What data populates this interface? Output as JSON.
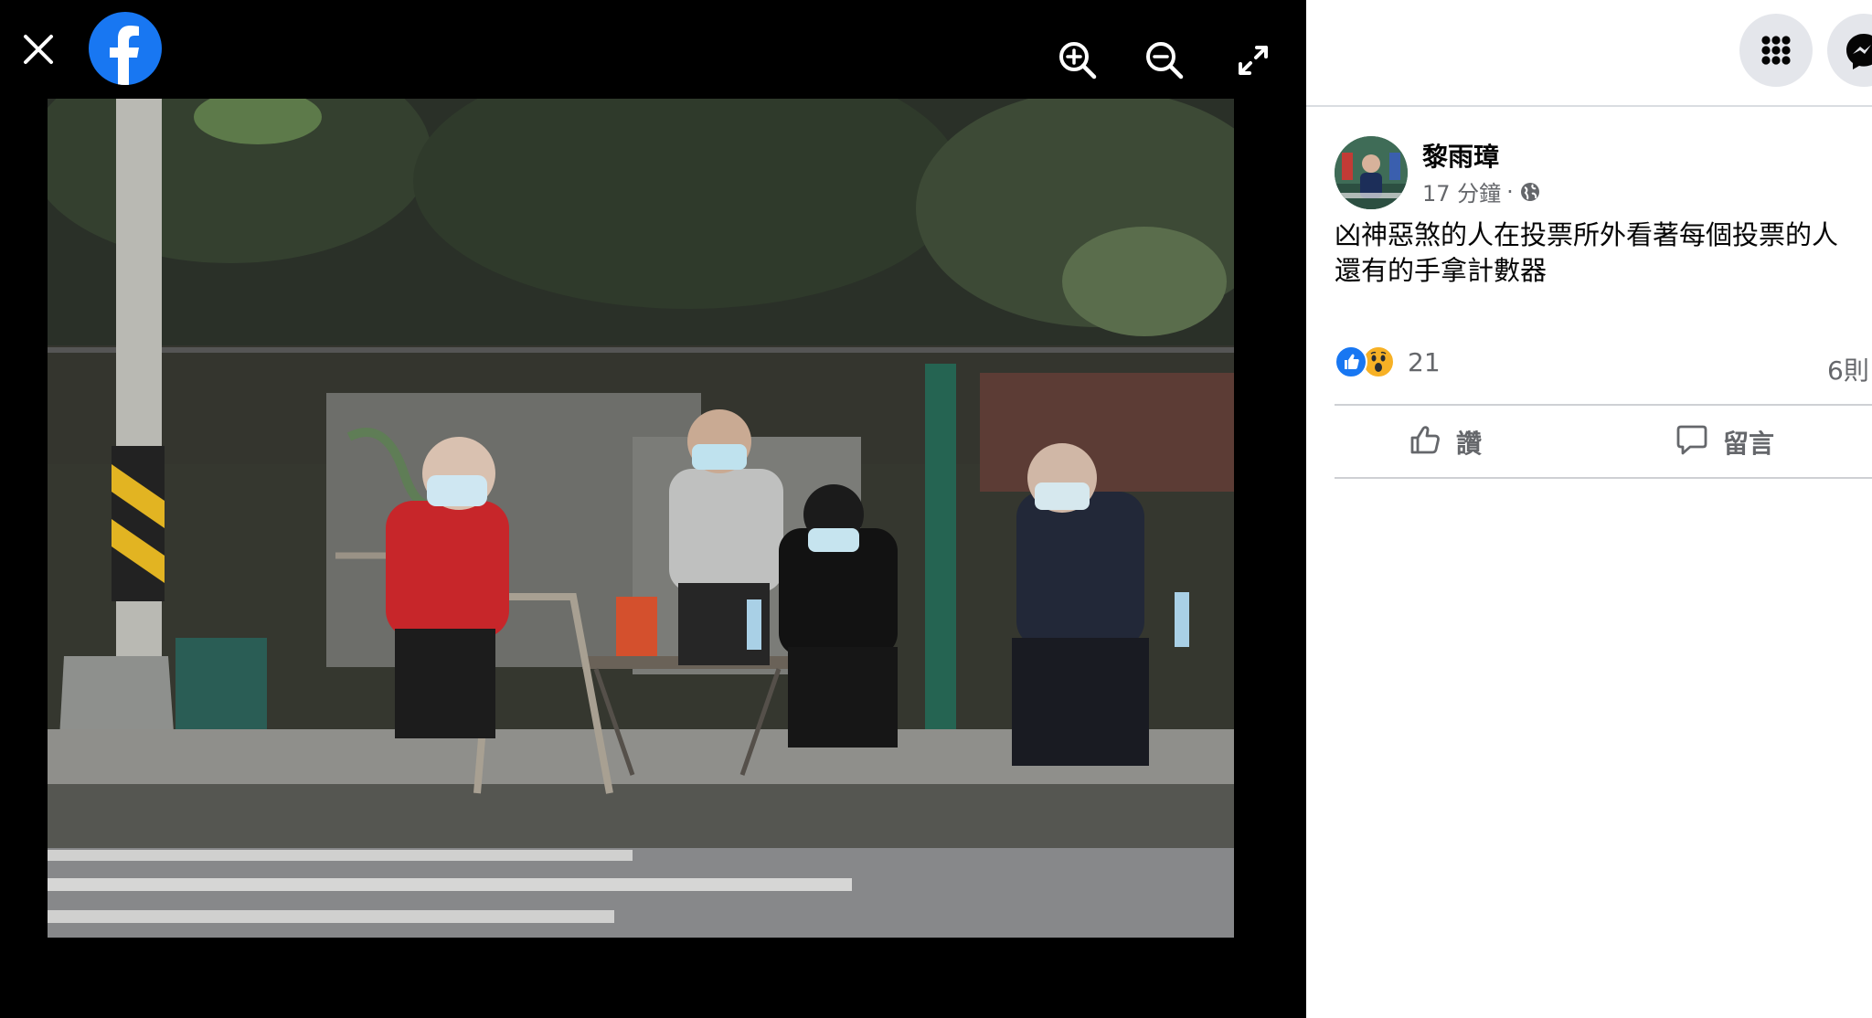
{
  "viewer": {
    "close_icon": "close-icon",
    "logo_icon": "facebook-logo-icon",
    "zoom_in_icon": "zoom-in-icon",
    "zoom_out_icon": "zoom-out-icon",
    "fullscreen_icon": "fullscreen-icon",
    "background_color": "#000000",
    "logo_color": "#1877f2"
  },
  "header": {
    "menu_icon": "grid-menu-icon",
    "messenger_icon": "messenger-icon"
  },
  "post": {
    "author": "黎雨璋",
    "time": "17 分鐘",
    "separator": "·",
    "privacy_icon": "globe-icon",
    "text_line1": "凶神惡煞的人在投票所外看著每個投票的人",
    "text_line2": "還有的手拿計數器",
    "reaction_icons": [
      "like-reaction-icon",
      "wow-reaction-icon"
    ],
    "reaction_count": "21",
    "comment_count": "6則"
  },
  "actions": {
    "like_label": "讚",
    "comment_label": "留言"
  },
  "colors": {
    "text_primary": "#050505",
    "text_secondary": "#65676b",
    "like_blue": "#1877f2",
    "wow_yellow": "#f7b125",
    "divider": "#ced0d4"
  }
}
